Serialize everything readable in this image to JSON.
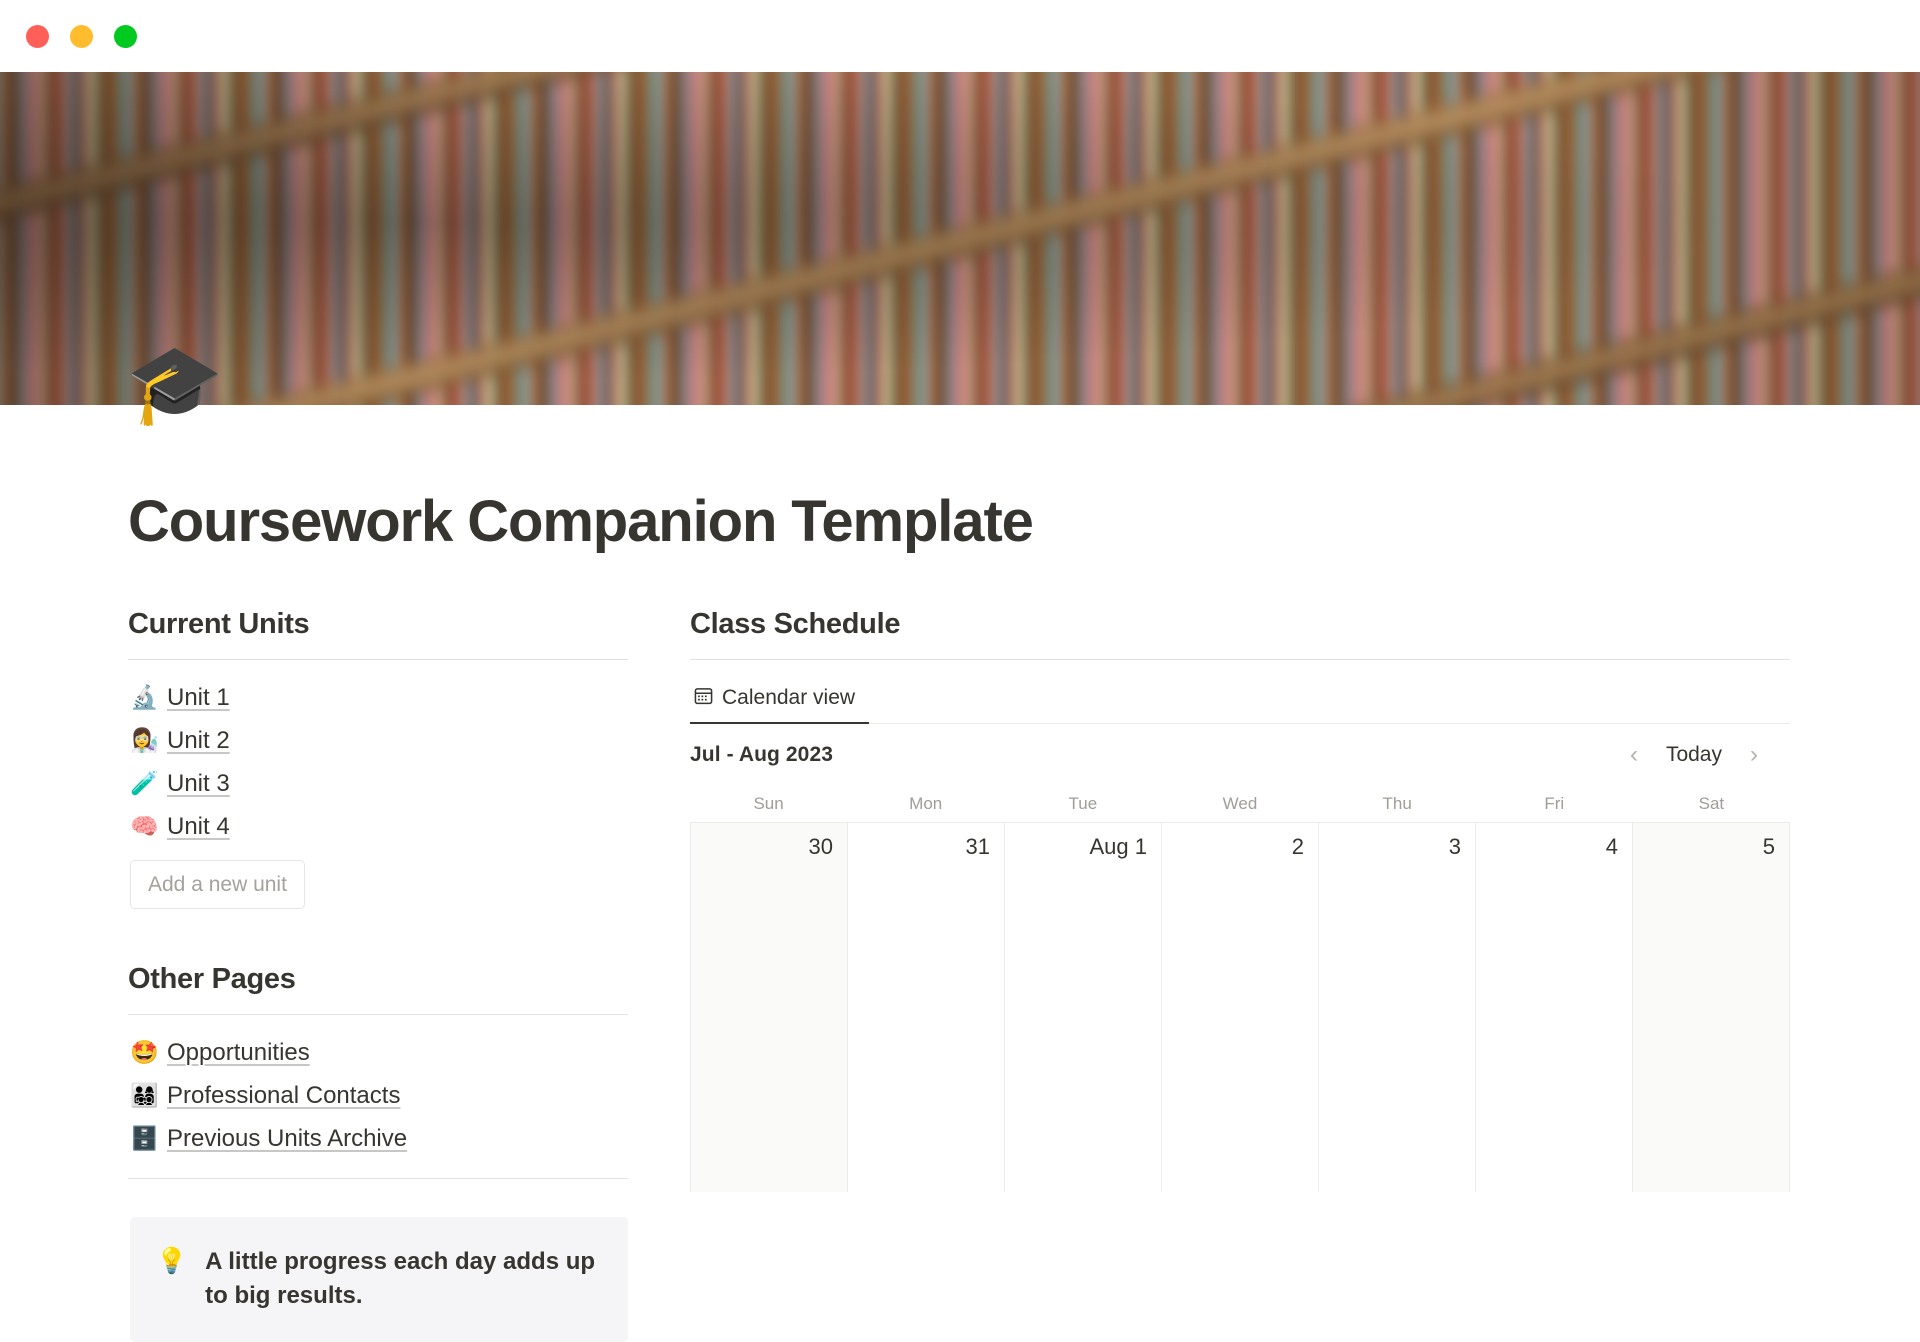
{
  "window": {
    "controls": [
      {
        "name": "close",
        "color": "#FF5F57"
      },
      {
        "name": "minimize",
        "color": "#FFBD2E"
      },
      {
        "name": "maximize",
        "color": "#00C91F"
      }
    ]
  },
  "page": {
    "icon": "🎓",
    "title": "Coursework Companion Template",
    "cover_description": "blurred library bookshelves"
  },
  "current_units": {
    "heading": "Current Units",
    "items": [
      {
        "emoji": "🔬",
        "label": "Unit 1"
      },
      {
        "emoji": "👩‍🔬",
        "label": "Unit 2"
      },
      {
        "emoji": "🧪",
        "label": "Unit 3"
      },
      {
        "emoji": "🧠",
        "label": "Unit 4"
      }
    ],
    "add_button_label": "Add a new unit"
  },
  "other_pages": {
    "heading": "Other Pages",
    "items": [
      {
        "emoji": "🤩",
        "label": "Opportunities"
      },
      {
        "emoji": "👨‍👩‍👧‍👦",
        "label": "Professional Contacts"
      },
      {
        "emoji": "🗄️",
        "label": "Previous Units Archive"
      }
    ]
  },
  "callout": {
    "emoji": "💡",
    "text": "A little progress each day adds up to big results."
  },
  "class_schedule": {
    "heading": "Class Schedule",
    "tabs": [
      {
        "label": "Calendar view",
        "icon": "calendar-icon",
        "active": true
      }
    ],
    "calendar": {
      "range_label": "Jul - Aug 2023",
      "today_label": "Today",
      "prev_label": "‹",
      "next_label": "›",
      "weekdays": [
        "Sun",
        "Mon",
        "Tue",
        "Wed",
        "Thu",
        "Fri",
        "Sat"
      ],
      "days": [
        {
          "label": "30",
          "weekend": true
        },
        {
          "label": "31",
          "weekend": false
        },
        {
          "label": "Aug 1",
          "weekend": false
        },
        {
          "label": "2",
          "weekend": false
        },
        {
          "label": "3",
          "weekend": false
        },
        {
          "label": "4",
          "weekend": false
        },
        {
          "label": "5",
          "weekend": true
        }
      ]
    }
  },
  "colors": {
    "text": "#37352F",
    "muted": "#A09D97",
    "divider": "#E4E2DE",
    "callout_bg": "#F5F4F7",
    "weekend_bg": "#FAFAF9"
  }
}
